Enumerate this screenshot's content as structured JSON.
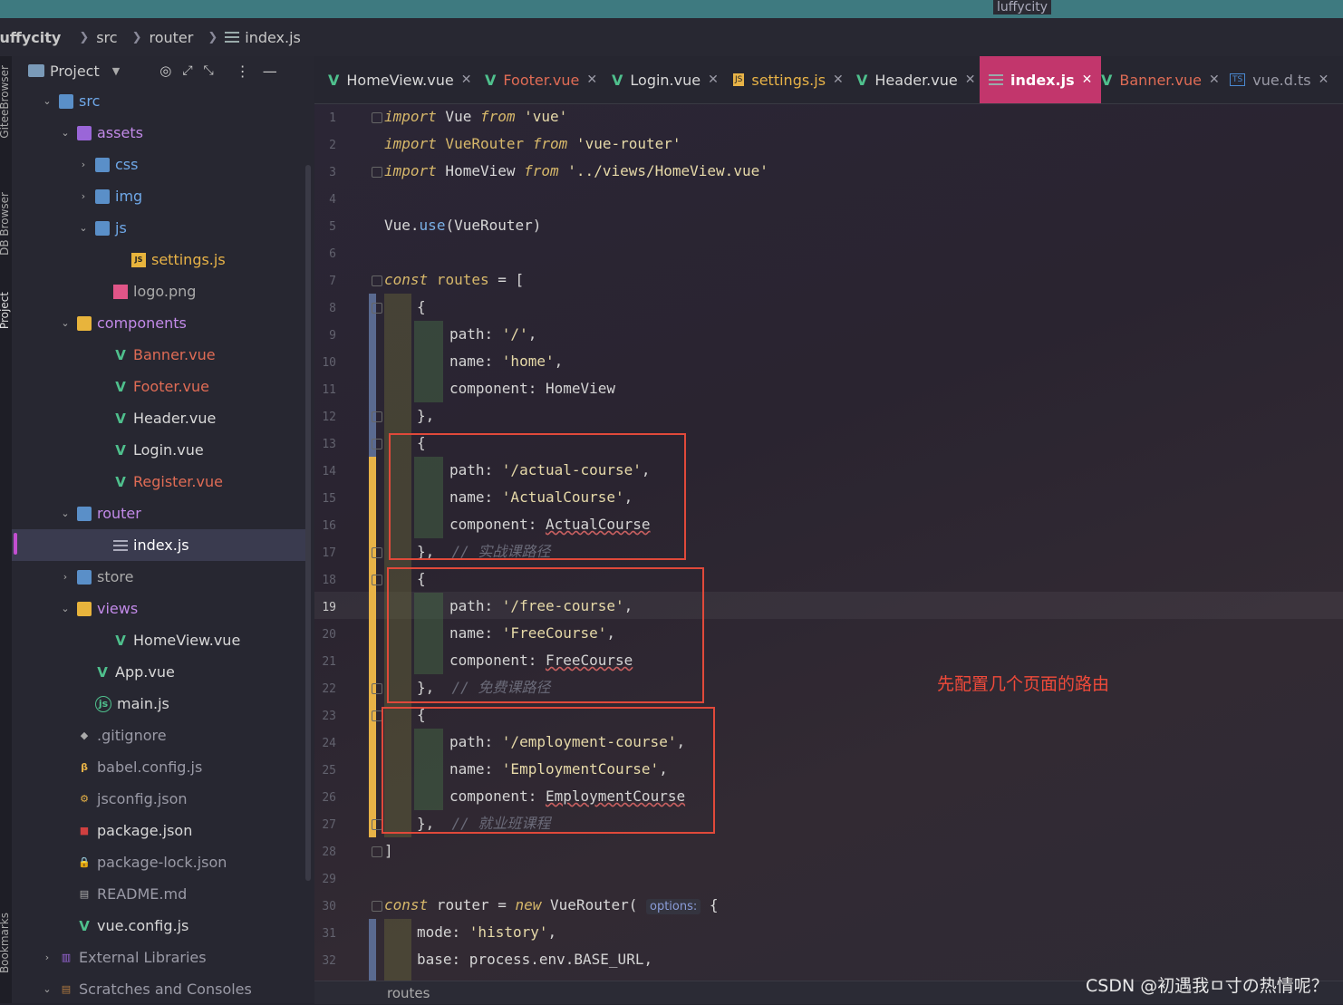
{
  "window": {
    "title": "luffycity"
  },
  "nav": {
    "project": "luffycity",
    "crumb1": "src",
    "crumb2": "router",
    "crumb3": "index.js"
  },
  "side_tabs": {
    "t1": "GiteeBrowser",
    "t2": "DB Browser",
    "t3": "Project",
    "t4": "Bookmarks"
  },
  "sidebar": {
    "header": "Project"
  },
  "tree": [
    {
      "label": "src",
      "depth": 1,
      "arrow": "v",
      "icon": "folder-src-icon",
      "color": "#6fa8e8"
    },
    {
      "label": "assets",
      "depth": 2,
      "arrow": "v",
      "icon": "folder-purple-icon",
      "color": "#c28ae8"
    },
    {
      "label": "css",
      "depth": 3,
      "arrow": ">",
      "icon": "folder-icon",
      "color": "#6fa8e8"
    },
    {
      "label": "img",
      "depth": 3,
      "arrow": ">",
      "icon": "folder-img-icon",
      "color": "#6fa8e8"
    },
    {
      "label": "js",
      "depth": 3,
      "arrow": "v",
      "icon": "folder-js-icon",
      "color": "#6fa8e8"
    },
    {
      "label": "settings.js",
      "depth": 5,
      "arrow": "",
      "icon": "js-file-icon",
      "color": "#e8b347"
    },
    {
      "label": "logo.png",
      "depth": 4,
      "arrow": "",
      "icon": "image-file-icon",
      "color": "#aaaaaa"
    },
    {
      "label": "components",
      "depth": 2,
      "arrow": "v",
      "icon": "folder-yellow-icon",
      "color": "#c28ae8"
    },
    {
      "label": "Banner.vue",
      "depth": 4,
      "arrow": "",
      "icon": "vue-icon",
      "color": "#e06c55"
    },
    {
      "label": "Footer.vue",
      "depth": 4,
      "arrow": "",
      "icon": "vue-icon",
      "color": "#e06c55"
    },
    {
      "label": "Header.vue",
      "depth": 4,
      "arrow": "",
      "icon": "vue-icon",
      "color": "#d8d8d8"
    },
    {
      "label": "Login.vue",
      "depth": 4,
      "arrow": "",
      "icon": "vue-icon",
      "color": "#d8d8d8"
    },
    {
      "label": "Register.vue",
      "depth": 4,
      "arrow": "",
      "icon": "vue-icon",
      "color": "#e06c55"
    },
    {
      "label": "router",
      "depth": 2,
      "arrow": "v",
      "icon": "folder-router-icon",
      "color": "#c28ae8"
    },
    {
      "label": "index.js",
      "depth": 4,
      "arrow": "",
      "icon": "js-lines-icon",
      "color": "#ffffff",
      "selected": true
    },
    {
      "label": "store",
      "depth": 2,
      "arrow": ">",
      "icon": "folder-store-icon",
      "color": "#aaaaaa"
    },
    {
      "label": "views",
      "depth": 2,
      "arrow": "v",
      "icon": "folder-yellow-icon",
      "color": "#c28ae8"
    },
    {
      "label": "HomeView.vue",
      "depth": 4,
      "arrow": "",
      "icon": "vue-icon",
      "color": "#d8d8d8"
    },
    {
      "label": "App.vue",
      "depth": 3,
      "arrow": "",
      "icon": "vue-icon",
      "color": "#d8d8d8"
    },
    {
      "label": "main.js",
      "depth": 3,
      "arrow": "",
      "icon": "js-circle-icon",
      "color": "#d8d8d8"
    },
    {
      "label": ".gitignore",
      "depth": 2,
      "arrow": "",
      "icon": "git-icon",
      "color": "#9a9aa6"
    },
    {
      "label": "babel.config.js",
      "depth": 2,
      "arrow": "",
      "icon": "babel-icon",
      "color": "#9a9aa6"
    },
    {
      "label": "jsconfig.json",
      "depth": 2,
      "arrow": "",
      "icon": "json-gear-icon",
      "color": "#9a9aa6"
    },
    {
      "label": "package.json",
      "depth": 2,
      "arrow": "",
      "icon": "npm-icon",
      "color": "#d8d8d8"
    },
    {
      "label": "package-lock.json",
      "depth": 2,
      "arrow": "",
      "icon": "lock-icon",
      "color": "#9a9aa6"
    },
    {
      "label": "README.md",
      "depth": 2,
      "arrow": "",
      "icon": "markdown-icon",
      "color": "#9a9aa6"
    },
    {
      "label": "vue.config.js",
      "depth": 2,
      "arrow": "",
      "icon": "vue-icon",
      "color": "#d8d8d8"
    },
    {
      "label": "External Libraries",
      "depth": 1,
      "arrow": ">",
      "icon": "library-icon",
      "color": "#9a9aa6"
    },
    {
      "label": "Scratches and Consoles",
      "depth": 1,
      "arrow": "v",
      "icon": "scratch-icon",
      "color": "#9a9aa6"
    }
  ],
  "tabs": [
    {
      "label": "HomeView.vue",
      "icon": "vue-icon",
      "color": "#d8d8d8"
    },
    {
      "label": "Footer.vue",
      "icon": "vue-icon",
      "color": "#e06c55"
    },
    {
      "label": "Login.vue",
      "icon": "vue-icon",
      "color": "#d8d8d8"
    },
    {
      "label": "settings.js",
      "icon": "js-file-icon",
      "color": "#e8b347"
    },
    {
      "label": "Header.vue",
      "icon": "vue-icon",
      "color": "#d8d8d8"
    },
    {
      "label": "index.js",
      "icon": "js-lines-icon",
      "color": "#ffffff",
      "active": true
    },
    {
      "label": "Banner.vue",
      "icon": "vue-icon",
      "color": "#e06c55"
    },
    {
      "label": "vue.d.ts",
      "icon": "ts-file-icon",
      "color": "#9a9aa6"
    }
  ],
  "code": {
    "l1": [
      "import",
      " Vue ",
      "from",
      " 'vue'"
    ],
    "l2": [
      "import",
      " VueRouter ",
      "from",
      " 'vue-router'"
    ],
    "l3": [
      "import",
      " HomeView ",
      "from",
      " '../views/HomeView.vue'"
    ],
    "l5": [
      "Vue",
      ".",
      "use",
      "(VueRouter)"
    ],
    "l7": [
      "const",
      " routes",
      " = ["
    ],
    "l8": "{",
    "l9": [
      "path: ",
      "'/'",
      ","
    ],
    "l10": [
      "name: ",
      "'home'",
      ","
    ],
    "l11": "component: HomeView",
    "l12": "},",
    "l13": "{",
    "l14": [
      "path: ",
      "'/actual-course'",
      ","
    ],
    "l15": [
      "name: ",
      "'ActualCourse'",
      ","
    ],
    "l16": [
      "component: ",
      "ActualCourse"
    ],
    "l17": [
      "},  ",
      "// 实战课路径"
    ],
    "l18": "{",
    "l19": [
      "path: ",
      "'/free-course'",
      ","
    ],
    "l20": [
      "name: ",
      "'FreeCourse'",
      ","
    ],
    "l21": [
      "component: ",
      "FreeCourse"
    ],
    "l22": [
      "},  ",
      "// 免费课路径"
    ],
    "l23": "{",
    "l24": [
      "path: ",
      "'/employment-course'",
      ","
    ],
    "l25": [
      "name: ",
      "'EmploymentCourse'",
      ","
    ],
    "l26": [
      "component: ",
      "EmploymentCourse"
    ],
    "l27": [
      "},  ",
      "// 就业班课程"
    ],
    "l28": "]",
    "l30": [
      "const",
      " router = ",
      "new",
      " VueRouter( ",
      "options:",
      " {"
    ],
    "l31": [
      "mode: ",
      "'history'",
      ","
    ],
    "l32": "base: process.env.BASE_URL,"
  },
  "line_numbers": [
    "1",
    "2",
    "3",
    "4",
    "5",
    "6",
    "7",
    "8",
    "9",
    "10",
    "11",
    "12",
    "13",
    "14",
    "15",
    "16",
    "17",
    "18",
    "19",
    "20",
    "21",
    "22",
    "23",
    "24",
    "25",
    "26",
    "27",
    "28",
    "29",
    "30",
    "31",
    "32"
  ],
  "annotation": "先配置几个页面的路由",
  "status": {
    "breadcrumb": "routes"
  },
  "watermark": "CSDN @初遇我ㅁ寸の热情呢？"
}
